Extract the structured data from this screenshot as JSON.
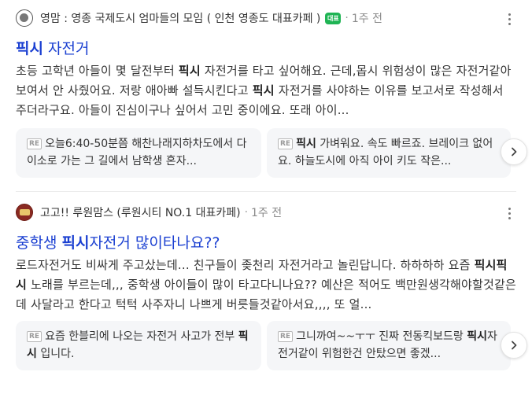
{
  "results": [
    {
      "source_name": "영맘 : 영종 국제도시 엄마들의 모임 ( 인천 영종도 대표카페 )",
      "badge": "대표",
      "time": "1주 전",
      "title_bold": "픽시",
      "title_rest": " 자전거",
      "snippet": [
        {
          "t": "초등 고학년 아들이 몇 달전부터 "
        },
        {
          "t": "픽시",
          "b": true
        },
        {
          "t": " 자전거를 타고 싶어해요. 근데,몹시 위험성이 많은 자전거같아 보여서 안 사줬어요. 저랑 애아빠 설득시킨다고 "
        },
        {
          "t": "픽시",
          "b": true
        },
        {
          "t": " 자전거를 사야하는 이유를 보고서로 작성해서 주더라구요. 아들이 진심이구나 싶어서 고민 중이에요. 또래 아이..."
        }
      ],
      "cards": [
        [
          {
            "t": "RE",
            "re": true
          },
          {
            "t": "오늘6:40-50분쯤 해찬나래지하차도에서 다이소로 가는 그 길에서 남학생 혼자..."
          }
        ],
        [
          {
            "t": "RE",
            "re": true
          },
          {
            "t": "픽시",
            "b": true
          },
          {
            "t": " 가벼워요. 속도 빠르죠. 브레이크 없어요. 하늘도시에 아직 아이 키도 작은..."
          }
        ]
      ]
    },
    {
      "source_name": "고고!! 루원맘스 (루원시티 NO.1 대표카페)",
      "time": "1주 전",
      "title_pre": "중학생 ",
      "title_bold": "픽시",
      "title_rest": "자전거 많이타나요??",
      "snippet": [
        {
          "t": "로드자전거도 비싸게 주고샀는데... 친구들이 좆천리 자전거라고 놀린답니다. 하하하하 요즘 "
        },
        {
          "t": "픽시픽시",
          "b": true
        },
        {
          "t": " 노래를 부르는데,,, 중학생 아이들이 많이 타고다니나요?? 예산은 적어도 백만원생각해야할것같은데 사달라고 한다고 턱턱 사주자니 나쁘게 버릇들것같아서요,,,, 또 얼..."
        }
      ],
      "cards": [
        [
          {
            "t": "RE",
            "re": true
          },
          {
            "t": "요즘 한블리에 나오는 자전거 사고가 전부 "
          },
          {
            "t": "픽시",
            "b": true
          },
          {
            "t": " 입니다."
          }
        ],
        [
          {
            "t": "RE",
            "re": true
          },
          {
            "t": "그니까여~~ㅜㅜ 진짜 전동킥보드랑 "
          },
          {
            "t": "픽시",
            "b": true
          },
          {
            "t": "자전거같이 위험한건 안탔으면 좋겠..."
          }
        ]
      ]
    }
  ],
  "colors": {
    "title_link": "#1a3fd1",
    "badge_bg": "#1fb454",
    "card_bg": "#f5f6f8"
  },
  "icons": {
    "more": "more-vertical-icon",
    "next": "chevron-right-icon",
    "reply": "reply-re-icon"
  }
}
